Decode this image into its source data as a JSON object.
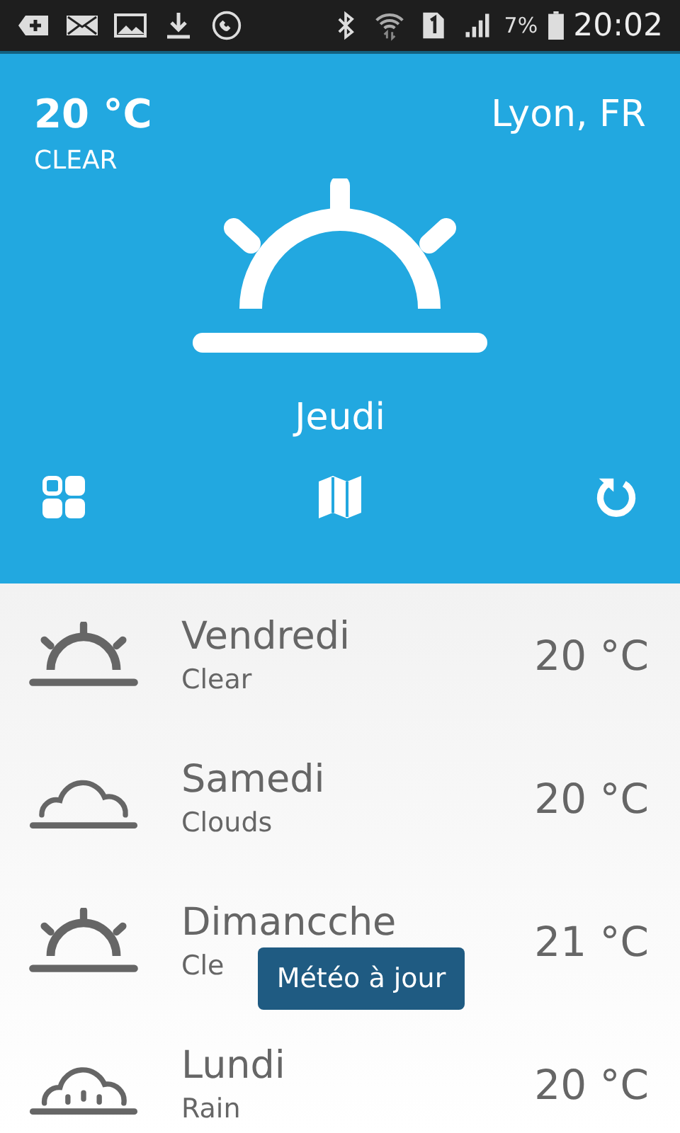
{
  "status_bar": {
    "battery_text": "7%",
    "time": "20:02"
  },
  "current": {
    "temperature": "20 °C",
    "condition": "CLEAR",
    "location": "Lyon, FR",
    "day": "Jeudi",
    "kind": "sun"
  },
  "forecast": [
    {
      "day": "Vendredi",
      "condition": "Clear",
      "temperature": "20 °C",
      "kind": "sun"
    },
    {
      "day": "Samedi",
      "condition": "Clouds",
      "temperature": "20 °C",
      "kind": "cloud"
    },
    {
      "day": "Dimancche",
      "condition": "Cle",
      "temperature": "21 °C",
      "kind": "sun"
    },
    {
      "day": "Lundi",
      "condition": "Rain",
      "temperature": "20 °C",
      "kind": "rain"
    }
  ],
  "toast": {
    "message": "Météo à jour"
  }
}
